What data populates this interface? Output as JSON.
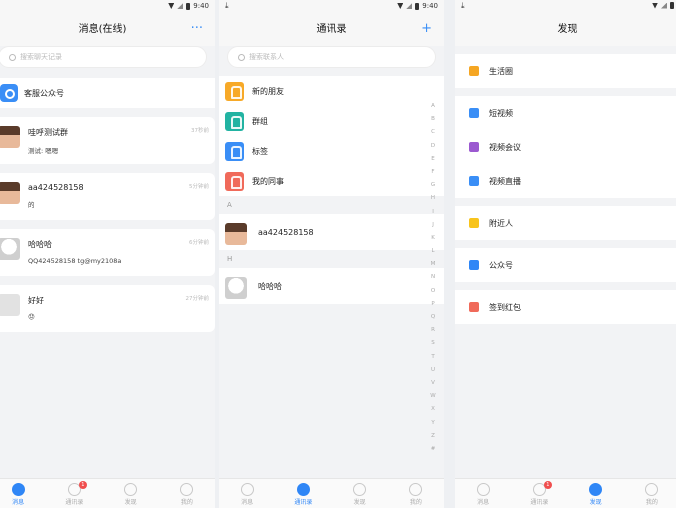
{
  "status": {
    "time": "9:40"
  },
  "messages": {
    "title": "消息(在线)",
    "more_icon": "···",
    "search_placeholder": "搜索聊天记录",
    "service_account": "客服公众号",
    "chats": [
      {
        "name": "哇呼测试群",
        "preview": "测试: 嗯嗯",
        "time": "37秒前",
        "avatar": "girl"
      },
      {
        "name": "aa424528158",
        "preview": "的",
        "time": "5分钟前",
        "avatar": "girl"
      },
      {
        "name": "哈哈哈",
        "preview": "QQ424528158 tg@my2108a",
        "time": "6分钟前",
        "avatar": "cartoon"
      },
      {
        "name": "好好",
        "preview": "😞",
        "time": "27分钟前",
        "avatar": "blank"
      }
    ]
  },
  "contacts": {
    "title": "通讯录",
    "add_icon": "+",
    "search_placeholder": "搜索联系人",
    "fixed": [
      {
        "label": "新的朋友",
        "color": "#f7a928"
      },
      {
        "label": "群组",
        "color": "#22b3a2"
      },
      {
        "label": "标签",
        "color": "#3a8ef6"
      },
      {
        "label": "我的同事",
        "color": "#f06a5a"
      }
    ],
    "sections": [
      {
        "letter": "A",
        "people": [
          {
            "name": "aa424528158",
            "avatar": "girl"
          }
        ]
      },
      {
        "letter": "H",
        "people": [
          {
            "name": "哈哈哈",
            "avatar": "cartoon"
          }
        ]
      }
    ],
    "alphabet": [
      "A",
      "B",
      "C",
      "D",
      "E",
      "F",
      "G",
      "H",
      "I",
      "J",
      "K",
      "L",
      "M",
      "N",
      "O",
      "P",
      "Q",
      "R",
      "S",
      "T",
      "U",
      "V",
      "W",
      "X",
      "Y",
      "Z",
      "#"
    ]
  },
  "discover": {
    "title": "发现",
    "groups": [
      [
        {
          "label": "生活圈",
          "color": "#f5a623"
        }
      ],
      [
        {
          "label": "短视频",
          "color": "#3a8ef6"
        },
        {
          "label": "视频会议",
          "color": "#9b59d0"
        },
        {
          "label": "视频直播",
          "color": "#3a8ef6"
        }
      ],
      [
        {
          "label": "附近人",
          "color": "#f8c41c"
        }
      ],
      [
        {
          "label": "公众号",
          "color": "#2f86f6"
        }
      ],
      [
        {
          "label": "签到红包",
          "color": "#f06a5a"
        }
      ]
    ]
  },
  "tabs": [
    "消息",
    "通讯录",
    "发现",
    "我的"
  ],
  "tab_badge": "1"
}
